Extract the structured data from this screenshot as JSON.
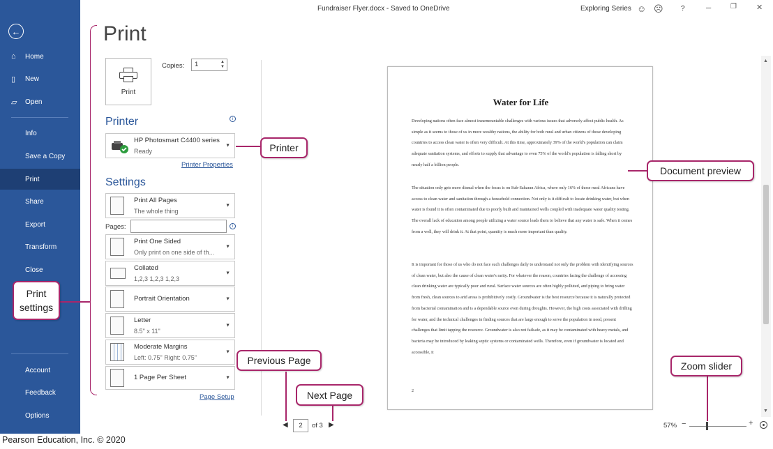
{
  "titlebar": {
    "document": "Fundraiser Flyer.docx  -  Saved to OneDrive",
    "user": "Exploring Series",
    "help": "?"
  },
  "sidebar": {
    "items": [
      {
        "label": "Home",
        "icon": "home-icon"
      },
      {
        "label": "New",
        "icon": "new-document-icon"
      },
      {
        "label": "Open",
        "icon": "folder-open-icon"
      },
      {
        "label": "Info"
      },
      {
        "label": "Save a Copy"
      },
      {
        "label": "Print",
        "active": true
      },
      {
        "label": "Share"
      },
      {
        "label": "Export"
      },
      {
        "label": "Transform"
      },
      {
        "label": "Close"
      },
      {
        "label": "Account"
      },
      {
        "label": "Feedback"
      },
      {
        "label": "Options"
      }
    ],
    "colors": {
      "background": "#2b579a",
      "active": "#1e3f74"
    }
  },
  "print": {
    "heading": "Print",
    "button_label": "Print",
    "copies_label": "Copies:",
    "copies_value": "1"
  },
  "printer": {
    "heading": "Printer",
    "name": "HP Photosmart C4400 series",
    "status": "Ready",
    "properties_link": "Printer Properties"
  },
  "settings": {
    "heading": "Settings",
    "pages_label": "Pages:",
    "pages_value": "",
    "items": [
      {
        "l1": "Print All Pages",
        "l2": "The whole thing"
      },
      {
        "l1": "Print One Sided",
        "l2": "Only print on one side of th..."
      },
      {
        "l1": "Collated",
        "l2": "1,2,3    1,2,3    1,2,3"
      },
      {
        "l1": "Portrait Orientation",
        "l2": ""
      },
      {
        "l1": "Letter",
        "l2": "8.5\" x 11\""
      },
      {
        "l1": "Moderate Margins",
        "l2": "Left:  0.75\"    Right:  0.75\""
      },
      {
        "l1": "1 Page Per Sheet",
        "l2": ""
      }
    ],
    "page_setup_link": "Page Setup"
  },
  "preview": {
    "title": "Water for Life",
    "paragraphs": [
      "Developing nations often face almost insurmountable challenges with various issues that adversely affect public health. As simple as it seems to those of us in more wealthy nations, the ability for both rural and urban citizens of those developing countries to access clean water is often very difficult. At this time, approximately 39% of the world's population can claim adequate sanitation systems, and efforts to supply that advantage to even 75% of the world's population is falling short by nearly half a billion people.",
      "The situation only gets more dismal when the focus is on Sub-Saharan Africa, where only 16% of those rural Africans have access to clean water and sanitation through a household connection. Not only is it difficult to locate drinking water, but when water is found it is often contaminated due to poorly built and maintained wells coupled with inadequate water quality testing. The overall lack of education among people utilizing a water source leads them to believe that any water is safe. When it comes from a well, they will drink it. At that point, quantity is much more important than quality.",
      "It is important for those of us who do not face such challenges daily to understand not only the problem with identifying sources of clean water, but also the cause of clean water's rarity. For whatever the reason, countries facing the challenge of accessing clean drinking water are typically poor and rural. Surface water sources are often highly polluted, and piping to bring water from fresh, clean sources to arid areas is prohibitively costly. Groundwater is the best resource because it is naturally protected from bacterial contamination and is a dependable source even during droughts. However, the high costs associated with drilling for water, and the technical challenges in finding sources that are large enough to serve the population in need, present challenges that limit tapping the resource. Groundwater is also not failsafe, as it may be contaminated with heavy metals, and bacteria may be introduced by leaking septic systems or contaminated wells. Therefore, even if groundwater is located and accessible, it"
    ],
    "page_number": "2"
  },
  "navigation": {
    "current_page": "2",
    "of_label": "of 3"
  },
  "zoom": {
    "percent_label": "57%",
    "minus": "−",
    "plus": "+",
    "level": 0.3
  },
  "callouts": {
    "printer": "Printer",
    "document_preview": "Document preview",
    "print_settings": "Print settings",
    "previous_page": "Previous Page",
    "next_page": "Next Page",
    "zoom_slider": "Zoom slider"
  },
  "footer": "Pearson Education, Inc. © 2020",
  "accent_color": "#a8266a"
}
